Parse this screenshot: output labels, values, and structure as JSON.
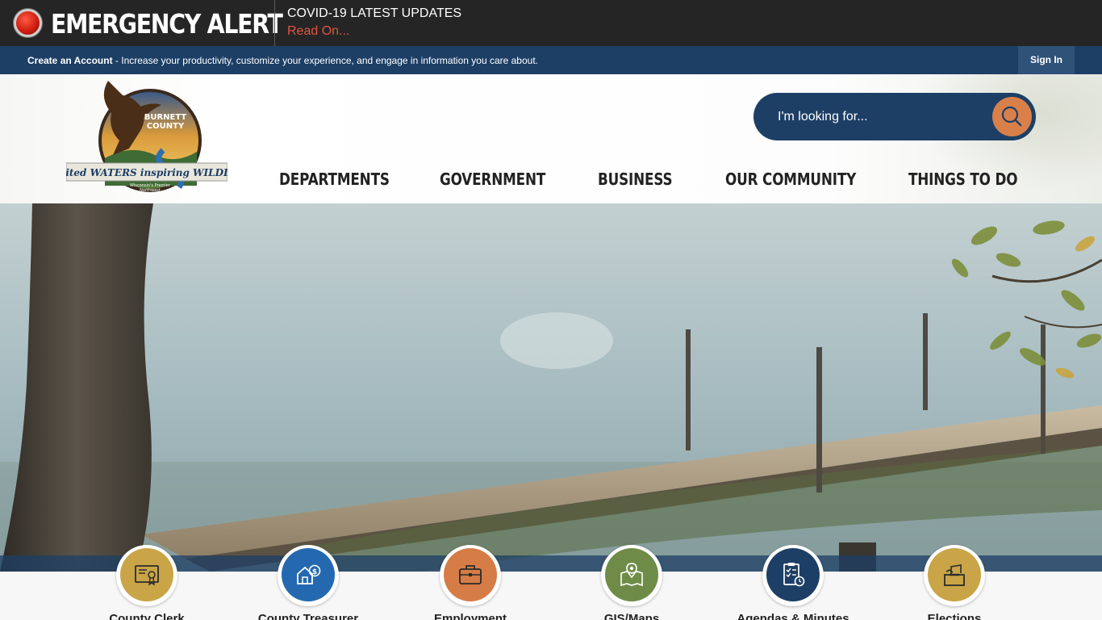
{
  "alert": {
    "title": "EMERGENCY ALERT",
    "headline": "COVID-19 LATEST UPDATES",
    "link": "Read On..."
  },
  "account": {
    "create_label": "Create an Account",
    "tagline": " - Increase your productivity, customize your experience, and engage in information you care about.",
    "sign_in": "Sign In"
  },
  "logo": {
    "line1": "BURNETT",
    "line2": "COUNTY",
    "banner": "spirited WATERS inspiring WILDLIFE",
    "sub1": "Wisconsin's Premier",
    "sub2": "Northwest"
  },
  "search": {
    "placeholder": "I'm looking for..."
  },
  "nav": [
    "DEPARTMENTS",
    "GOVERNMENT",
    "BUSINESS",
    "OUR COMMUNITY",
    "THINGS TO DO"
  ],
  "quick_links": [
    {
      "label": "County Clerk",
      "icon": "certificate-icon",
      "color": "#c9a547"
    },
    {
      "label": "County Treasurer",
      "icon": "house-money-icon",
      "color": "#2469b0"
    },
    {
      "label": "Employment",
      "icon": "briefcase-icon",
      "color": "#d67c47"
    },
    {
      "label": "GIS/Maps",
      "icon": "map-pin-icon",
      "color": "#6e8c47"
    },
    {
      "label": "Agendas & Minutes",
      "icon": "checklist-icon",
      "color": "#1d3f66"
    },
    {
      "label": "Elections",
      "icon": "ballot-box-icon",
      "color": "#c9a547"
    }
  ],
  "colors": {
    "alert_bg": "#252525",
    "alert_link": "#e0553e",
    "navy": "#1d3f66",
    "search_button": "#d9804a"
  }
}
